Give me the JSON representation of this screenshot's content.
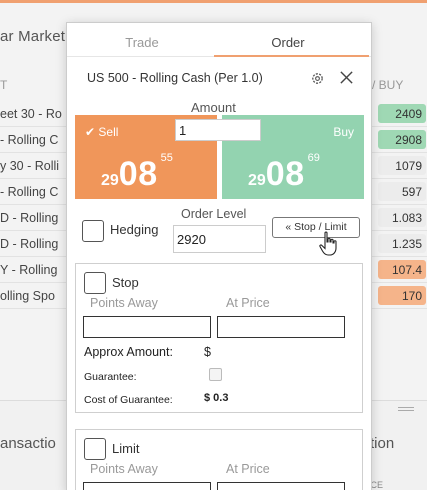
{
  "background": {
    "title": "ar Market",
    "col_left": "T",
    "col_right": "/ BUY",
    "rows": [
      {
        "name": "eet 30 - Ro",
        "price": "2409",
        "color": "green"
      },
      {
        "name": "- Rolling C",
        "price": "2908",
        "color": "green"
      },
      {
        "name": "y 30 - Rolli",
        "price": "1079",
        "color": "gray"
      },
      {
        "name": "- Rolling C",
        "price": "597",
        "color": "gray"
      },
      {
        "name": "D - Rolling",
        "price": "1.083",
        "color": "gray"
      },
      {
        "name": "D - Rolling",
        "price": "1.235",
        "color": "gray"
      },
      {
        "name": "Y - Rolling",
        "price": "107.4",
        "color": "orange"
      },
      {
        "name": "olling Spo",
        "price": "170",
        "color": "orange"
      }
    ],
    "lower_left": "ansactio",
    "lower_right": "tion",
    "lower_right_small": "ICE"
  },
  "dialog": {
    "tabs": {
      "trade": "Trade",
      "order": "Order"
    },
    "instrument": "US 500 - Rolling Cash (Per 1.0)",
    "amount_label": "Amount",
    "amount_value": "1",
    "sell": {
      "label": "✔ Sell",
      "small": "29",
      "big": "08",
      "sup": "55"
    },
    "buy": {
      "label": "Buy",
      "small": "29",
      "big": "08",
      "sup": "69"
    },
    "hedging_label": "Hedging",
    "order_level_label": "Order Level",
    "order_level_value": "2920",
    "stop_limit_button": "« Stop / Limit",
    "stop": {
      "title": "Stop",
      "points_away": "Points Away",
      "at_price": "At Price",
      "approx_label": "Approx Amount:",
      "approx_value": "$",
      "guarantee_label": "Guarantee:",
      "cost_label": "Cost of Guarantee:",
      "cost_value": "$ 0.3"
    },
    "limit": {
      "title": "Limit",
      "points_away": "Points Away",
      "at_price": "At Price"
    }
  },
  "colors": {
    "sell": "#f0965a",
    "buy": "#93d3b0",
    "accent": "#f0a070"
  },
  "icons": [
    "gear-icon",
    "close-icon",
    "check-icon",
    "hand-cursor-icon"
  ]
}
